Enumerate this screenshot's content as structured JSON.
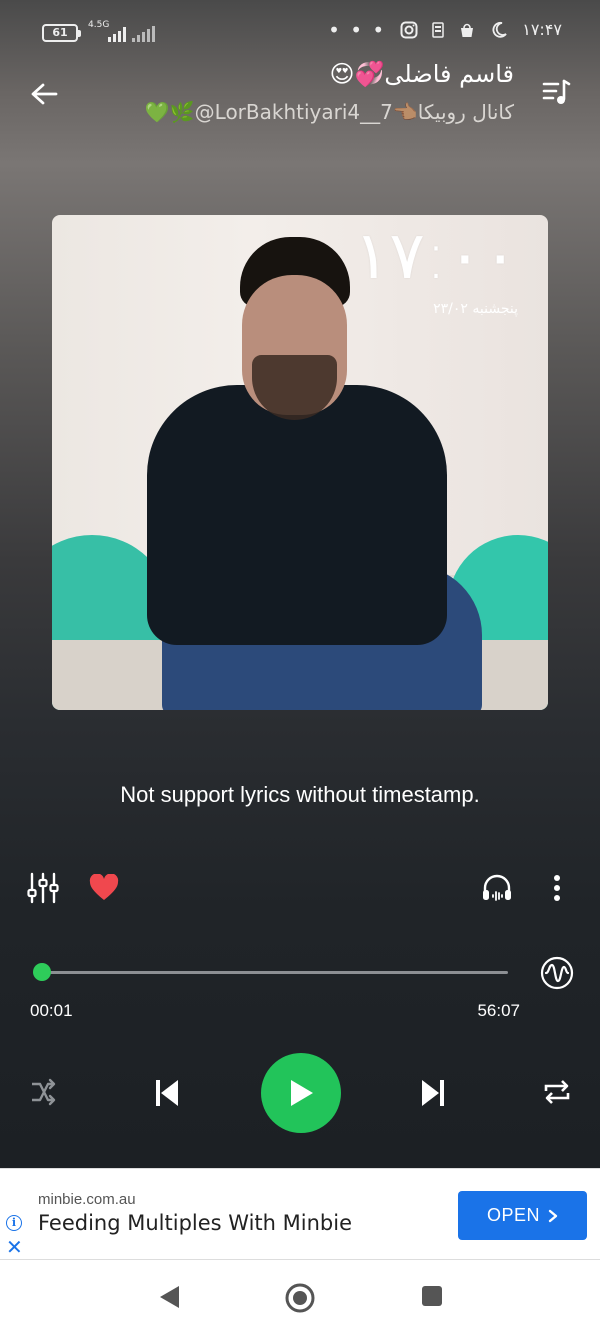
{
  "status_bar": {
    "battery": "61",
    "network": "4.5G",
    "dots": "• • •",
    "time": "۱۷:۴۷"
  },
  "header": {
    "title": "قاسم فاضلی💞😍",
    "subtitle": "کانال روبیکا👈🏽7__LorBakhtiyari4@🌿💚"
  },
  "album_art": {
    "clock": "۱۷:۰۰",
    "date": "پنجشنبه ۲۳/۰۲"
  },
  "lyrics_message": "Not support lyrics without timestamp.",
  "playback": {
    "current_time": "00:01",
    "total_time": "56:07",
    "progress_fraction": 0.0
  },
  "ad": {
    "domain": "minbie.com.au",
    "headline": "Feeding Multiples With Minbie",
    "cta": "OPEN"
  },
  "colors": {
    "accent": "#22c45a",
    "heart": "#f0484e",
    "ad_button": "#1a73e8"
  }
}
